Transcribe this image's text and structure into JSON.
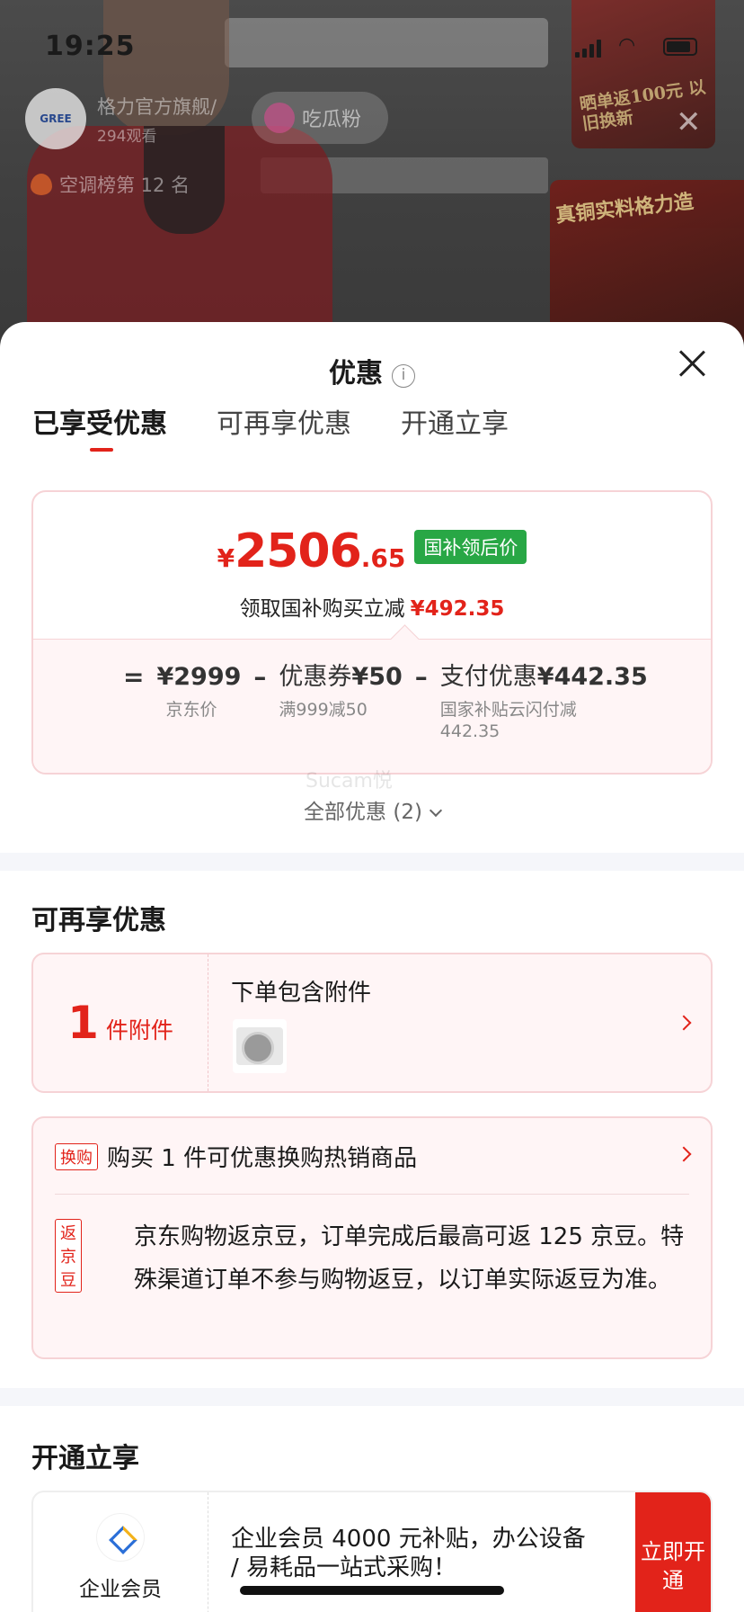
{
  "status_bar": {
    "time": "19:25"
  },
  "stream": {
    "brand_logo": "GREE",
    "streamer_name": "格力官方旗舰/",
    "viewers": "294观看",
    "chip_label": "吃瓜粉",
    "rank_text": "空调榜第 12 名",
    "promo_top_text": "晒单返100元 以旧换新",
    "promo_side_text": "真铜实料格力造"
  },
  "sheet": {
    "title": "优惠",
    "tabs": [
      {
        "label": "已享受优惠",
        "active": true
      },
      {
        "label": "可再享优惠",
        "active": false
      },
      {
        "label": "开通立享",
        "active": false
      }
    ],
    "price": {
      "currency": "¥",
      "integer": "2506",
      "decimal": ".65",
      "badge": "国补领后价",
      "subsidy_text": "领取国补购买立减",
      "subsidy_amount": "¥492.35"
    },
    "breakdown": {
      "eq": "=",
      "minus": "–",
      "jd_price": "¥2999",
      "jd_price_label": "京东价",
      "coupon_label": "优惠券",
      "coupon_amount": "¥50",
      "coupon_desc": "满999减50",
      "pay_label": "支付优惠",
      "pay_amount": "¥442.35",
      "pay_desc_1": "国家补贴云闪付减",
      "pay_desc_2": "442.35"
    },
    "watermark": "Sucam悦",
    "all_offers": "全部优惠 (2)",
    "more_section": {
      "title": "可再享优惠",
      "attachment": {
        "count": "1",
        "unit": "件附件",
        "title": "下单包含附件"
      },
      "exchange": {
        "tag": "换购",
        "text": "购买 1 件可优惠换购热销商品",
        "bean_tag": "返京豆",
        "bean_text": "京东购物返京豆，订单完成后最高可返 125 京豆。特殊渠道订单不参与购物返豆，以订单实际返豆为准。"
      }
    },
    "open_section": {
      "title": "开通立享",
      "enterprise": {
        "label": "企业会员",
        "desc": "企业会员 4000 元补贴，办公设备 / 易耗品一站式采购！",
        "button": "立即开通"
      }
    }
  },
  "colors": {
    "accent": "#e2231a",
    "badge_green": "#28a745",
    "card_border": "#f6d3d6"
  }
}
